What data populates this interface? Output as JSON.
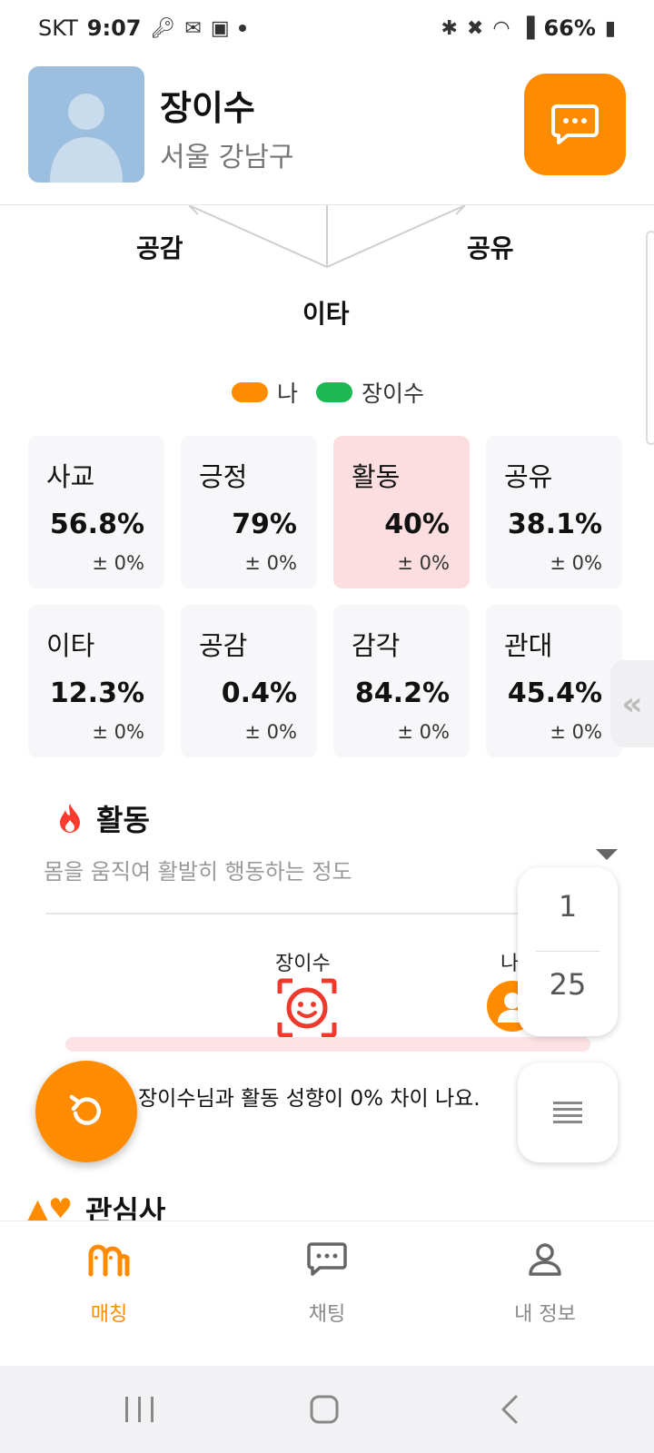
{
  "status_bar": {
    "carrier": "SKT",
    "time": "9:07",
    "battery": "66%"
  },
  "header": {
    "user_name": "장이수",
    "user_location": "서울 강남구"
  },
  "radar": {
    "labels": [
      "공감",
      "공유",
      "이타"
    ]
  },
  "legend": {
    "me_label": "나",
    "me_color": "#ff8c00",
    "other_label": "장이수",
    "other_color": "#1db954"
  },
  "traits": [
    {
      "name": "사교",
      "value": "56.8%",
      "diff": "± 0%"
    },
    {
      "name": "긍정",
      "value": "79%",
      "diff": "± 0%"
    },
    {
      "name": "활동",
      "value": "40%",
      "diff": "± 0%"
    },
    {
      "name": "공유",
      "value": "38.1%",
      "diff": "± 0%"
    },
    {
      "name": "이타",
      "value": "12.3%",
      "diff": "± 0%"
    },
    {
      "name": "공감",
      "value": "0.4%",
      "diff": "± 0%"
    },
    {
      "name": "감각",
      "value": "84.2%",
      "diff": "± 0%"
    },
    {
      "name": "관대",
      "value": "45.4%",
      "diff": "± 0%"
    }
  ],
  "detail": {
    "title": "활동",
    "description": "몸을 움직여 활발히 행동하는 정도",
    "other_name": "장이수",
    "me_label": "나",
    "comparison_text": "장이수님과 활동 성향이 0% 차이 나요."
  },
  "pager": {
    "current": "1",
    "total": "25"
  },
  "next_section": {
    "title": "관심사"
  },
  "bottom_nav": {
    "items": [
      {
        "label": "매칭",
        "icon": "matching-icon",
        "active": true
      },
      {
        "label": "채팅",
        "icon": "chat-icon",
        "active": false
      },
      {
        "label": "내 정보",
        "icon": "profile-icon",
        "active": false
      }
    ]
  },
  "colors": {
    "accent": "#ff8c00",
    "highlight_card": "#fcdde0"
  }
}
